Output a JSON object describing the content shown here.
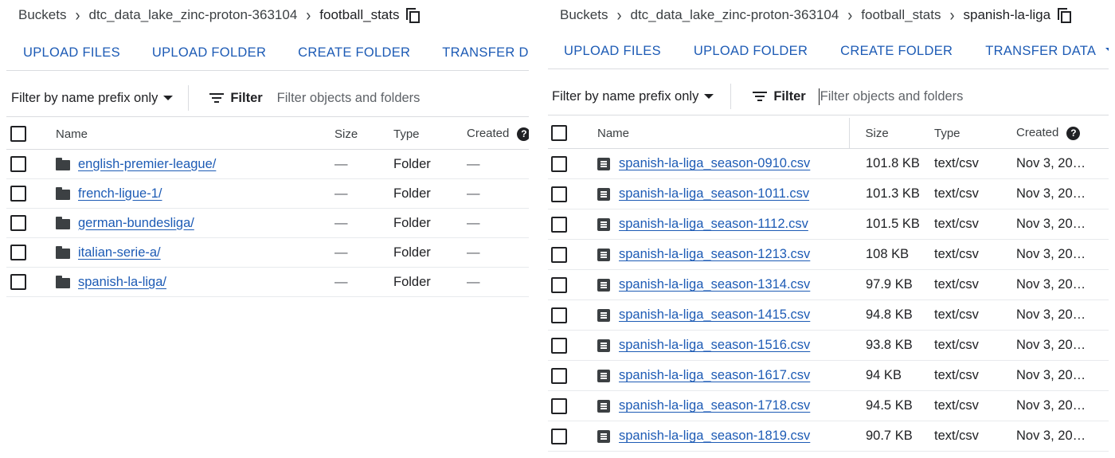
{
  "left": {
    "breadcrumb": [
      "Buckets",
      "dtc_data_lake_zinc-proton-363104",
      "football_stats"
    ],
    "actions": {
      "upload_files": "UPLOAD FILES",
      "upload_folder": "UPLOAD FOLDER",
      "create_folder": "CREATE FOLDER",
      "transfer_data": "TRANSFER DATA"
    },
    "filter": {
      "prefix_select": "Filter by name prefix only",
      "filter_label": "Filter",
      "placeholder": "Filter objects and folders"
    },
    "columns": {
      "name": "Name",
      "size": "Size",
      "type": "Type",
      "created": "Created"
    },
    "rows": [
      {
        "name": "english-premier-league/",
        "size": "—",
        "type": "Folder",
        "created": "—"
      },
      {
        "name": "french-ligue-1/",
        "size": "—",
        "type": "Folder",
        "created": "—"
      },
      {
        "name": "german-bundesliga/",
        "size": "—",
        "type": "Folder",
        "created": "—"
      },
      {
        "name": "italian-serie-a/",
        "size": "—",
        "type": "Folder",
        "created": "—"
      },
      {
        "name": "spanish-la-liga/",
        "size": "—",
        "type": "Folder",
        "created": "—"
      }
    ]
  },
  "right": {
    "breadcrumb": [
      "Buckets",
      "dtc_data_lake_zinc-proton-363104",
      "football_stats",
      "spanish-la-liga"
    ],
    "actions": {
      "upload_files": "UPLOAD FILES",
      "upload_folder": "UPLOAD FOLDER",
      "create_folder": "CREATE FOLDER",
      "transfer_data": "TRANSFER DATA"
    },
    "filter": {
      "prefix_select": "Filter by name prefix only",
      "filter_label": "Filter",
      "placeholder": "Filter objects and folders"
    },
    "columns": {
      "name": "Name",
      "size": "Size",
      "type": "Type",
      "created": "Created"
    },
    "rows": [
      {
        "name": "spanish-la-liga_season-0910.csv",
        "size": "101.8 KB",
        "type": "text/csv",
        "created": "Nov 3, 20…"
      },
      {
        "name": "spanish-la-liga_season-1011.csv",
        "size": "101.3 KB",
        "type": "text/csv",
        "created": "Nov 3, 20…"
      },
      {
        "name": "spanish-la-liga_season-1112.csv",
        "size": "101.5 KB",
        "type": "text/csv",
        "created": "Nov 3, 20…"
      },
      {
        "name": "spanish-la-liga_season-1213.csv",
        "size": "108 KB",
        "type": "text/csv",
        "created": "Nov 3, 20…"
      },
      {
        "name": "spanish-la-liga_season-1314.csv",
        "size": "97.9 KB",
        "type": "text/csv",
        "created": "Nov 3, 20…"
      },
      {
        "name": "spanish-la-liga_season-1415.csv",
        "size": "94.8 KB",
        "type": "text/csv",
        "created": "Nov 3, 20…"
      },
      {
        "name": "spanish-la-liga_season-1516.csv",
        "size": "93.8 KB",
        "type": "text/csv",
        "created": "Nov 3, 20…"
      },
      {
        "name": "spanish-la-liga_season-1617.csv",
        "size": "94 KB",
        "type": "text/csv",
        "created": "Nov 3, 20…"
      },
      {
        "name": "spanish-la-liga_season-1718.csv",
        "size": "94.5 KB",
        "type": "text/csv",
        "created": "Nov 3, 20…"
      },
      {
        "name": "spanish-la-liga_season-1819.csv",
        "size": "90.7 KB",
        "type": "text/csv",
        "created": "Nov 3, 20…"
      }
    ]
  },
  "icons": {
    "separator": "chevron-right-icon",
    "copy": "copy-icon",
    "folder": "folder-icon",
    "file": "file-icon",
    "help": "help-icon",
    "filter": "filter-icon"
  },
  "colors": {
    "link": "#1d5bb5",
    "text": "#202124",
    "divider": "#dadce0"
  }
}
